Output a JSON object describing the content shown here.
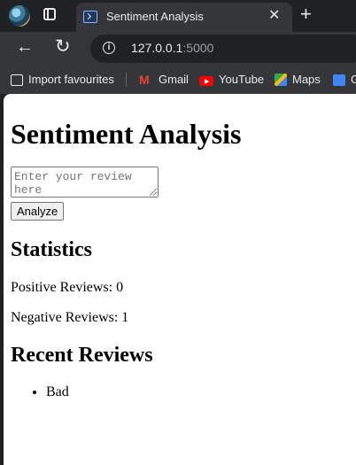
{
  "browser": {
    "tab_title": "Sentiment Analysis",
    "tab_close": "✕",
    "new_tab": "+",
    "url_host": "127.0.0.1",
    "url_port": ":5000",
    "bookmarks": [
      "Import favourites",
      "Gmail",
      "YouTube",
      "Maps",
      "G"
    ]
  },
  "page": {
    "heading": "Sentiment Analysis",
    "review_placeholder": "Enter your review here",
    "analyze_label": "Analyze",
    "statistics_heading": "Statistics",
    "positive_text": "Positive Reviews: 0",
    "negative_text": "Negative Reviews: 1",
    "recent_heading": "Recent Reviews",
    "recent_reviews": [
      "Bad"
    ]
  }
}
